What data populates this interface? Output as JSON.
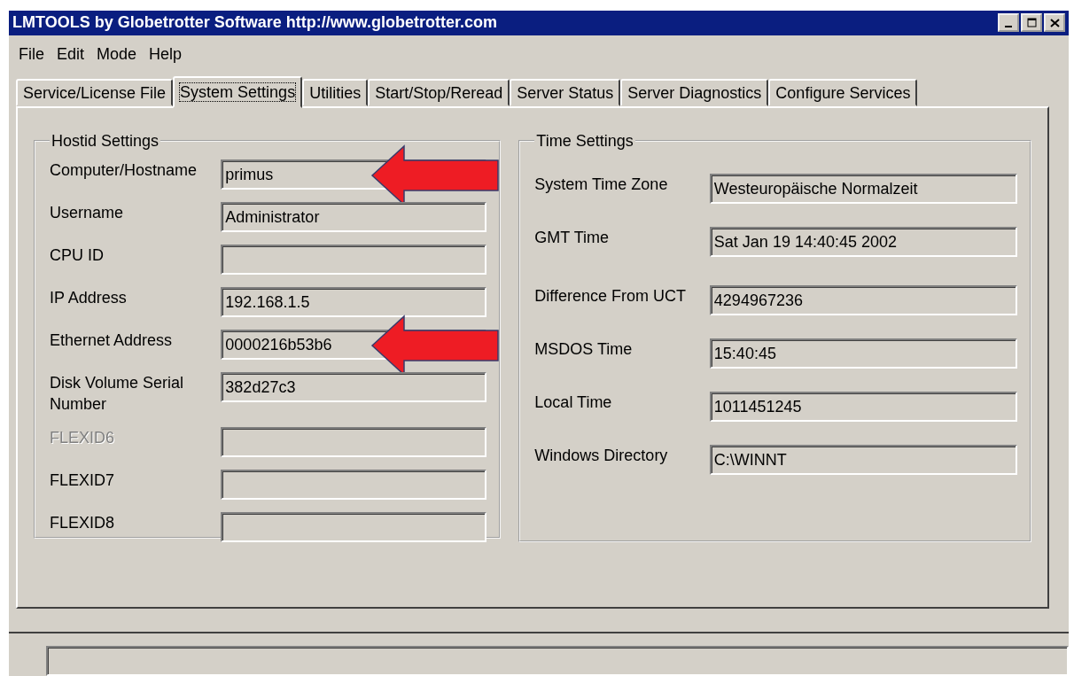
{
  "window": {
    "title": "LMTOOLS by Globetrotter Software http://www.globetrotter.com"
  },
  "menu": [
    "File",
    "Edit",
    "Mode",
    "Help"
  ],
  "tabs": [
    {
      "label": "Service/License File",
      "selected": false
    },
    {
      "label": "System Settings",
      "selected": true
    },
    {
      "label": "Utilities",
      "selected": false
    },
    {
      "label": "Start/Stop/Reread",
      "selected": false
    },
    {
      "label": "Server Status",
      "selected": false
    },
    {
      "label": "Server Diagnostics",
      "selected": false
    },
    {
      "label": "Configure Services",
      "selected": false
    }
  ],
  "hostid_settings": {
    "title": "Hostid Settings",
    "fields": [
      {
        "label": "Computer/Hostname",
        "value": "primus",
        "disabled": false,
        "arrow": true
      },
      {
        "label": "Username",
        "value": "Administrator",
        "disabled": false,
        "arrow": false
      },
      {
        "label": "CPU ID",
        "disabled": false,
        "arrow": false
      },
      {
        "label": "IP Address",
        "value": "192.168.1.5",
        "disabled": false,
        "arrow": false
      },
      {
        "label": "Ethernet Address",
        "value": "0000216b53b6",
        "disabled": false,
        "arrow": true
      },
      {
        "label": "Disk Volume Serial Number",
        "value": "382d27c3",
        "disabled": false,
        "arrow": false
      },
      {
        "label": "FLEXID6",
        "disabled": true,
        "arrow": false
      },
      {
        "label": "FLEXID7",
        "disabled": false,
        "arrow": false
      },
      {
        "label": "FLEXID8",
        "disabled": false,
        "arrow": false
      }
    ]
  },
  "time_settings": {
    "title": "Time Settings",
    "fields": [
      {
        "label": "System Time Zone",
        "value": "Westeuropäische Normalzeit"
      },
      {
        "label": "GMT Time",
        "value": "Sat Jan 19 14:40:45 2002"
      },
      {
        "label": "Difference From UCT",
        "value": "4294967236"
      },
      {
        "label": "MSDOS Time",
        "value": "15:40:45"
      },
      {
        "label": "Local Time",
        "value": "1011451245"
      },
      {
        "label": "Windows Directory",
        "value": "C:\\WINNT"
      }
    ]
  }
}
